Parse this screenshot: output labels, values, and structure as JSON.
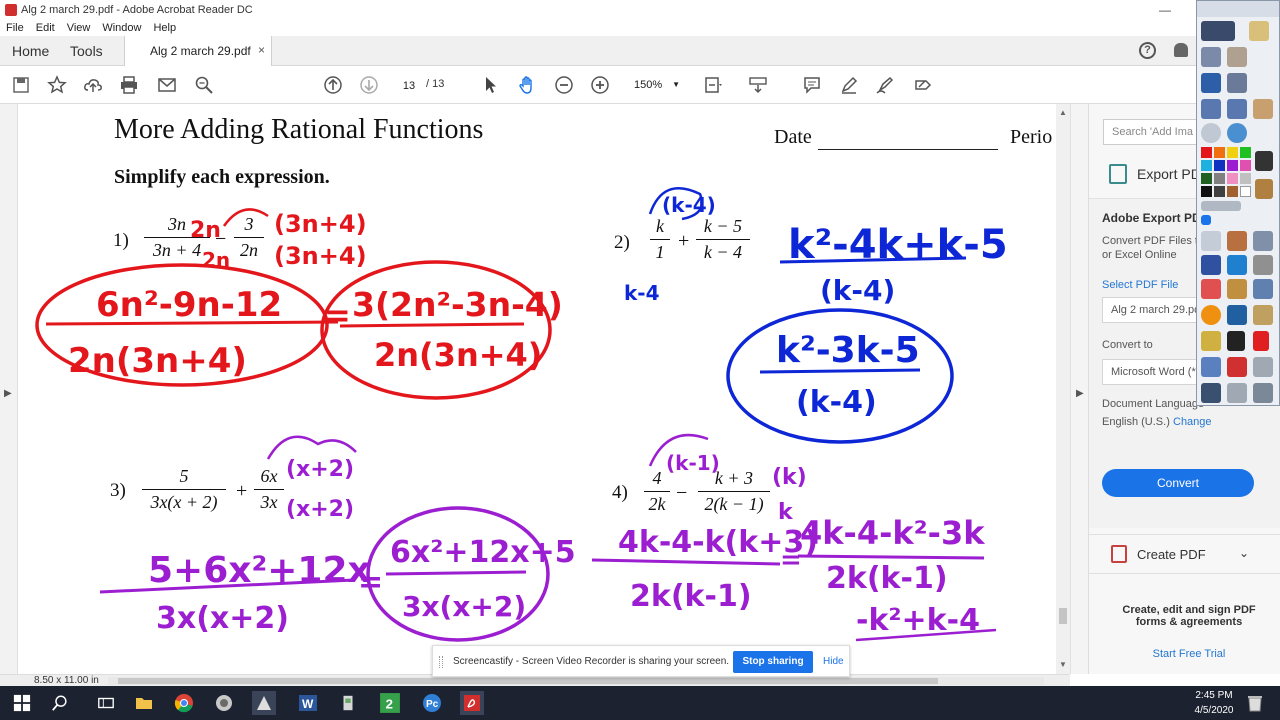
{
  "window": {
    "title": "Alg 2 march 29.pdf - Adobe Acrobat Reader DC",
    "minimize": "—",
    "close": "✕"
  },
  "menu": [
    "File",
    "Edit",
    "View",
    "Window",
    "Help"
  ],
  "tabs": {
    "home": "Home",
    "tools": "Tools",
    "document": "Alg 2 march 29.pdf",
    "close": "×"
  },
  "toolbar": {
    "page_current": "13",
    "page_total": "/ 13",
    "zoom": "150%"
  },
  "document": {
    "title": "More Adding Rational Functions",
    "date_label": "Date",
    "period_label": "Perio",
    "instructions": "Simplify each expression.",
    "problems": [
      {
        "num": "1)",
        "f1_num": "3n",
        "f1_den": "3n + 4",
        "op": "−",
        "f2_num": "3",
        "f2_den": "2n"
      },
      {
        "num": "2)",
        "f1_num": "k",
        "f1_den": "1",
        "op": "+",
        "f2_num": "k − 5",
        "f2_den": "k − 4"
      },
      {
        "num": "3)",
        "f1_num": "5",
        "f1_den": "3x(x + 2)",
        "op": "+",
        "f2_num": "6x",
        "f2_den": "3x"
      },
      {
        "num": "4)",
        "f1_num": "4",
        "f1_den": "2k",
        "op": "−",
        "f2_num": "k + 3",
        "f2_den": "2(k − 1)"
      }
    ],
    "ink": {
      "p1_mult_top": "2n",
      "p1_mult_top2": "(3n+4)",
      "p1_mult_bot": "2n",
      "p1_mult_bot2": "(3n+4)",
      "p1_work_num": "6n²-9n-12",
      "p1_work_den": "2n(3n+4)",
      "p1_ans_num": "3(2n²-3n-4)",
      "p1_ans_den": "2n(3n+4)",
      "p1_eq": "=",
      "p2_mult_top": "(k-4)",
      "p2_mult_bot": "k-4",
      "p2_work_num": "k²-4k+k-5",
      "p2_work_den": "(k-4)",
      "p2_ans_num": "k²-3k-5",
      "p2_ans_den": "(k-4)",
      "p3_mult_top": "(x+2)",
      "p3_mult_bot": "(x+2)",
      "p3_work_num": "5+6x²+12x",
      "p3_work_den": "3x(x+2)",
      "p3_eq": "=",
      "p3_ans_num": "6x²+12x+5",
      "p3_ans_den": "3x(x+2)",
      "p4_mult_top": "(k-1)",
      "p4_mult_k_top": "(k)",
      "p4_mult_k_bot": "k",
      "p4_work_num": "4k-4-k(k+3)",
      "p4_work_den": "2k(k-1)",
      "p4_eq": "=",
      "p4_work2_num": "4k-4-k²-3k",
      "p4_work2_den": "2k(k-1)",
      "p4_work3": "-k²+k-4"
    },
    "colors": {
      "red": "#e3161c",
      "blue": "#0e27d6",
      "purple": "#9b1fd0"
    }
  },
  "right_panel": {
    "search_placeholder": "Search 'Add Ima",
    "export_pdf": "Export PDF",
    "adobe_export": "Adobe Export PD",
    "export_desc1": "Convert PDF Files to",
    "export_desc2": "or Excel Online",
    "select_file": "Select PDF File",
    "selected_file": "Alg 2 march 29.pd",
    "convert_to": "Convert to",
    "convert_format": "Microsoft Word (*.",
    "doc_language": "Document Language",
    "language": "English (U.S.)",
    "change": "Change",
    "convert_button": "Convert",
    "create_pdf": "Create PDF",
    "promo1": "Create, edit and sign PDF",
    "promo2": "forms & agreements",
    "trial": "Start Free Trial"
  },
  "status": {
    "page_size": "8.50 x 11.00 in"
  },
  "screencastify": {
    "message": "Screencastify - Screen Video Recorder is sharing your screen.",
    "stop": "Stop sharing",
    "hide": "Hide"
  },
  "taskbar": {
    "time": "2:45 PM",
    "date": "4/5/2020"
  }
}
